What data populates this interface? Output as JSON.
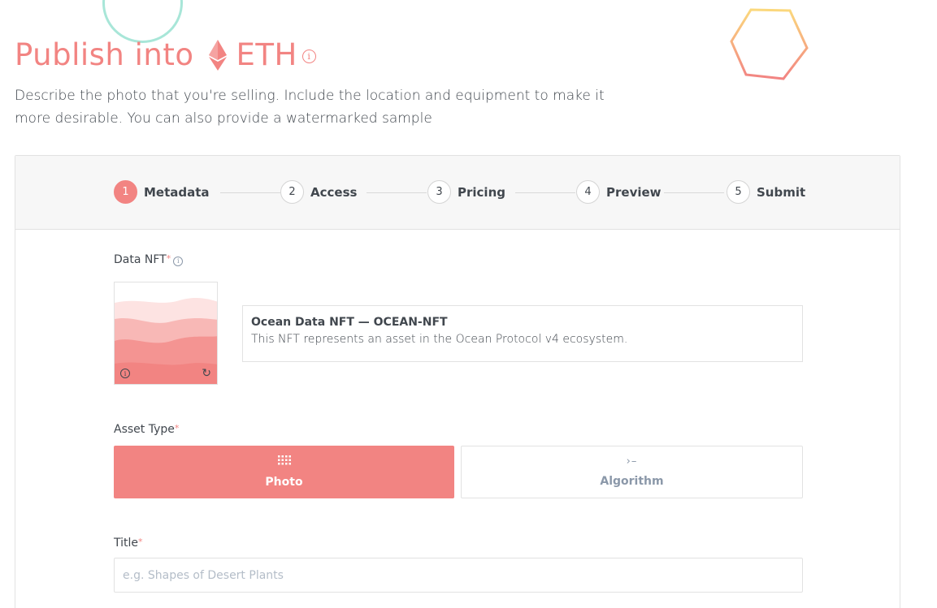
{
  "header": {
    "title_prefix": "Publish into",
    "network": "ETH",
    "description": "Describe the photo that you're selling. Include the location and equipment to make it more desirable. You can also provide a watermarked sample"
  },
  "steps": [
    {
      "number": "1",
      "label": "Metadata",
      "active": true
    },
    {
      "number": "2",
      "label": "Access"
    },
    {
      "number": "3",
      "label": "Pricing"
    },
    {
      "number": "4",
      "label": "Preview"
    },
    {
      "number": "5",
      "label": "Submit"
    }
  ],
  "data_nft": {
    "label": "Data NFT",
    "required_mark": "*",
    "name": "Ocean Data NFT — OCEAN-NFT",
    "description": "This NFT represents an asset in the Ocean Protocol v4 ecosystem."
  },
  "asset_type": {
    "label": "Asset Type",
    "required_mark": "*",
    "options": [
      {
        "label": "Photo",
        "icon": "grid-icon",
        "selected": true
      },
      {
        "label": "Algorithm",
        "icon": "terminal-icon",
        "selected": false
      }
    ]
  },
  "title_field": {
    "label": "Title",
    "required_mark": "*",
    "value": "",
    "placeholder": "e.g. Shapes of Desert Plants"
  },
  "colors": {
    "accent": "#f28482",
    "text": "#41474e",
    "muted": "#8b98a9"
  }
}
